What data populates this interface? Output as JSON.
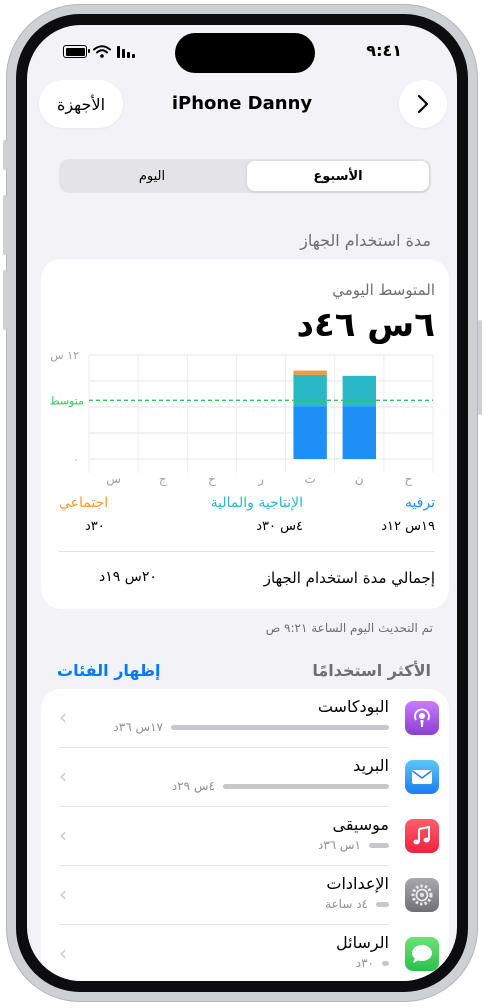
{
  "status": {
    "time": "٩:٤١"
  },
  "nav": {
    "back_label": "الأجهزة",
    "title": "iPhone Danny",
    "forward_icon": "chevron-right-icon"
  },
  "segments": {
    "week": "الأسبوع",
    "day": "اليوم",
    "selected": "week"
  },
  "usage": {
    "section_title": "مدة استخدام الجهاز",
    "avg_label": "المتوسط اليومي",
    "avg_value": "٦س ٤٦د",
    "total_label": "إجمالي مدة استخدام الجهاز",
    "total_value": "٢٠س ١٩د",
    "updated": "تم التحديث اليوم الساعة ٩:٢١ ص"
  },
  "chart_data": {
    "type": "bar",
    "categories": [
      "ح",
      "ن",
      "ث",
      "ر",
      "خ",
      "ج",
      "س"
    ],
    "ylim": [
      0,
      12
    ],
    "y_ticks": [
      "١٢ س",
      "٠"
    ],
    "average_label": "متوسط",
    "average_value": 6.77,
    "series": [
      {
        "name": "ترفيه",
        "color": "#1e8ff5",
        "values": [
          0,
          6.1,
          6.1,
          0,
          0,
          0,
          0
        ]
      },
      {
        "name": "الإنتاجية والمالية",
        "color": "#2ab8c9",
        "values": [
          0,
          3.5,
          3.6,
          0,
          0,
          0,
          0
        ]
      },
      {
        "name": "اجتماعي",
        "color": "#f19a3e",
        "values": [
          0,
          0,
          0.5,
          0,
          0,
          0,
          0
        ]
      }
    ],
    "legend": [
      {
        "name": "ترفيه",
        "value": "١٩س ١٢د",
        "color": "#1e8ff5"
      },
      {
        "name": "الإنتاجية والمالية",
        "value": "٤س ٣٠د",
        "color": "#2ab8c9"
      },
      {
        "name": "اجتماعي",
        "value": "٣٠د",
        "color": "#f19a3e"
      }
    ]
  },
  "most_used": {
    "title": "الأكثر استخدامًا",
    "show_categories": "إظهار الفئات",
    "apps": [
      {
        "name": "البودكاست",
        "time": "١٧س ٣٦د",
        "fraction": 1.0,
        "icon": "podcasts-icon",
        "color": "#9b59d0"
      },
      {
        "name": "البريد",
        "time": "٤س ٢٩د",
        "fraction": 0.76,
        "icon": "mail-icon",
        "color": "#1e8ff5"
      },
      {
        "name": "موسيقى",
        "time": "١س ٣٦د",
        "fraction": 0.09,
        "icon": "music-icon",
        "color": "#fa2d48"
      },
      {
        "name": "الإعدادات",
        "time": "٤د ساعة",
        "fraction": 0.06,
        "icon": "settings-icon",
        "color": "#8e8e93"
      },
      {
        "name": "الرسائل",
        "time": "٣٠د",
        "fraction": 0.03,
        "icon": "messages-icon",
        "color": "#34c759"
      }
    ]
  }
}
